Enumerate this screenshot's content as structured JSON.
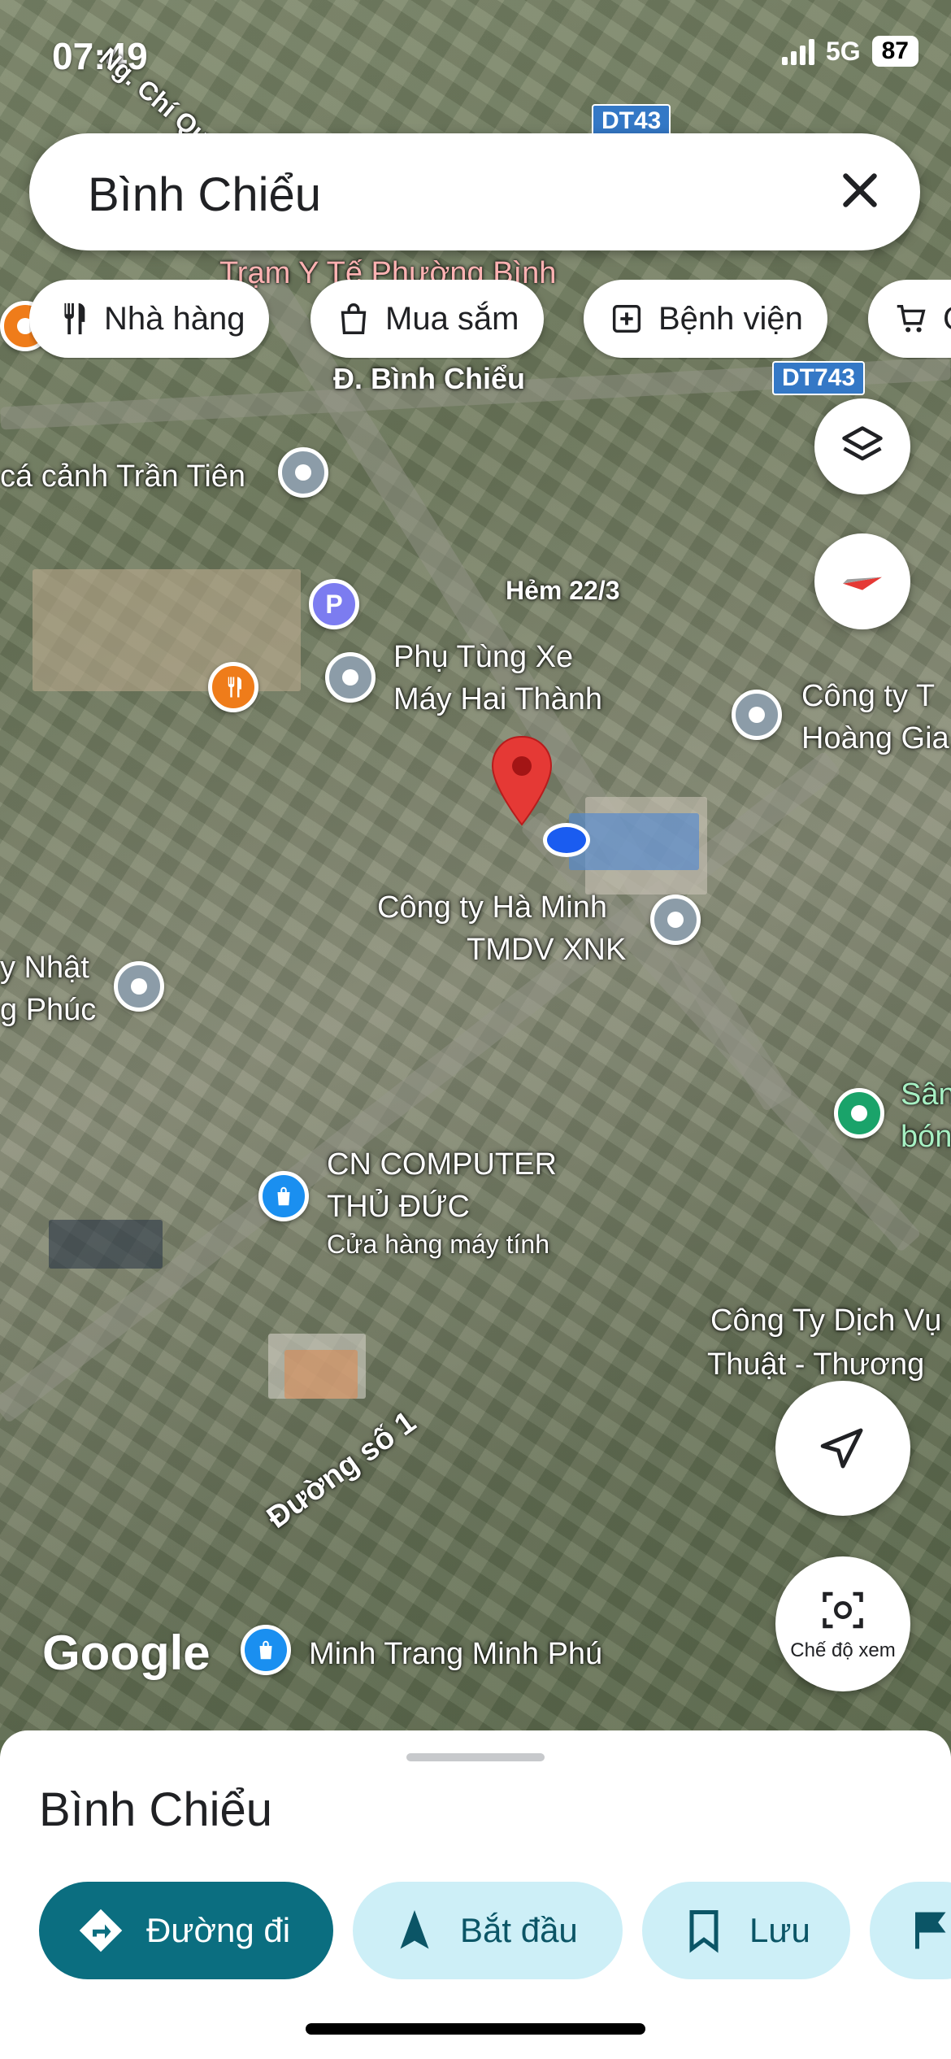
{
  "status_bar": {
    "time": "07:49",
    "network": "5G",
    "battery": "87"
  },
  "search": {
    "query": "Bình Chiểu"
  },
  "chips": [
    {
      "label": "Nhà hàng",
      "icon": "fork-knife-icon"
    },
    {
      "label": "Mua sắm",
      "icon": "shopping-bag-icon"
    },
    {
      "label": "Bệnh viện",
      "icon": "hospital-icon"
    },
    {
      "label": "C",
      "icon": "cart-icon"
    }
  ],
  "map": {
    "road_shields": [
      "DT43",
      "DT743"
    ],
    "streets": [
      "Ng. Chí Quốc",
      "Đ. Bình Chiểu",
      "Hẻm 22/3",
      "Đường số 1"
    ],
    "places": {
      "tram_y_te": "Trạm Y Tế Phường Bình",
      "ca_canh": "cá cảnh Trần Tiên",
      "phu_tung_1": "Phụ Tùng Xe",
      "phu_tung_2": "Máy Hai Thành",
      "cong_ty_hoang_1": "Công ty T",
      "cong_ty_hoang_2": "Hoàng Gia",
      "ha_minh_1": "Công ty Hà Minh",
      "ha_minh_2": "TMDV XNK",
      "nhat_1": "y Nhật",
      "nhat_2": "g Phúc",
      "san_1": "Sân",
      "san_2": "bón",
      "cn_computer_1": "CN COMPUTER",
      "cn_computer_2": "THỦ ĐỨC",
      "cn_computer_sub": "Cửa hàng máy tính",
      "dich_vu_1": "Công Ty Dịch Vụ",
      "dich_vu_2": "Thuật - Thương",
      "minh_trang": "Minh Trang Minh Phú"
    },
    "parking_letter": "P",
    "attribution": "Google"
  },
  "fabs": {
    "view_mode_label": "Chế độ xem"
  },
  "sheet": {
    "title": "Bình Chiểu",
    "actions": [
      {
        "label": "Đường đi",
        "icon": "directions-icon"
      },
      {
        "label": "Bắt đầu",
        "icon": "navigation-arrow-icon"
      },
      {
        "label": "Lưu",
        "icon": "bookmark-icon"
      },
      {
        "label": "",
        "icon": "flag-icon"
      }
    ]
  },
  "colors": {
    "accent": "#0b6e80",
    "accent_light": "#cdeff7",
    "pin_red": "#e53935",
    "location_blue": "#1a5cf0"
  }
}
